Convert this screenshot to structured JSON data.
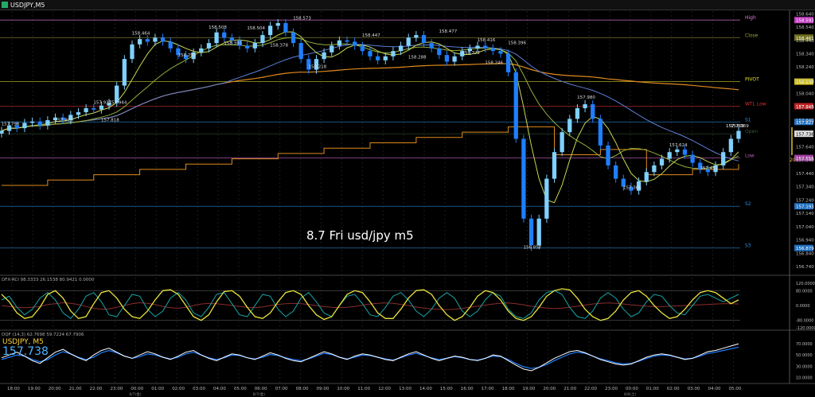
{
  "window": {
    "title": "USDJPY,M5"
  },
  "annotation_text": "8.7 Fri usd/jpy m5",
  "colors": {
    "background": "#000000",
    "candle_bull": "#7fd1ff",
    "candle_bear": "#1f7fff",
    "ma_fast": "#c8d650",
    "ma_mid": "#8fae3c",
    "ma_slow": "#5b7fd6",
    "ma_long": "#e08a1e",
    "pivot_band": "#e08a1e",
    "stoch_k": "#e7e33b",
    "stoch_d": "#16a6a6",
    "rci_long": "#8b2d2d",
    "dmi_main": "#ffffff",
    "dmi_sig": "#1f7fff"
  },
  "levels": [
    {
      "name": "High",
      "value": "158.593",
      "label_color": "#e07fe0",
      "tag_bg": "#c040c0"
    },
    {
      "name": "Close",
      "value": "158.461",
      "label_color": "#a0a040",
      "tag_bg": "#707020"
    },
    {
      "name": "PIVOT",
      "value": "158.130",
      "label_color": "#e0e030",
      "tag_bg": "#d0c020"
    },
    {
      "name": "WTL Low",
      "value": "157.945",
      "label_color": "#e03030",
      "tag_bg": "#c02020"
    },
    {
      "name": "S1",
      "value": "157.827",
      "label_color": "#3090e0",
      "tag_bg": "#2070c0"
    },
    {
      "name": "Open",
      "value": "157.738",
      "label_color": "#3a5a3a",
      "tag_bg": "#303030"
    },
    {
      "name": "Low",
      "value": "157.556",
      "label_color": "#c060c0",
      "tag_bg": "#a040a0"
    },
    {
      "name": "S2",
      "value": "157.193",
      "label_color": "#3090e0",
      "tag_bg": "#2070c0"
    },
    {
      "name": "S3",
      "value": "156.879",
      "label_color": "#3090e0",
      "tag_bg": "#2070c0"
    }
  ],
  "price_axis": [
    "158.640",
    "158.540",
    "158.440",
    "158.340",
    "158.240",
    "158.140",
    "158.040",
    "157.940",
    "157.840",
    "157.740",
    "157.640",
    "157.540",
    "157.440",
    "157.340",
    "157.240",
    "157.140",
    "157.040",
    "156.940",
    "156.840",
    "156.740"
  ],
  "current_price_tag": "157.738",
  "bid_tag": "157.769",
  "spread_label": "20",
  "chart_data": {
    "type": "candlestick",
    "title": "USDJPY,M5",
    "ylim": [
      156.68,
      158.66
    ],
    "x_ticks": [
      "18:00",
      "19:00",
      "20:00",
      "21:00",
      "22:00",
      "23:00",
      "00:00",
      "01:00",
      "02:00",
      "03:00",
      "04:00",
      "05:00",
      "06:00",
      "07:00",
      "08:00",
      "09:00",
      "10:00",
      "11:00",
      "12:00",
      "13:00",
      "14:00",
      "15:00",
      "16:00",
      "17:00",
      "18:00",
      "19:00",
      "20:00",
      "21:00",
      "22:00",
      "23:00",
      "00:00",
      "01:00",
      "02:00",
      "03:00",
      "04:00",
      "05:00"
    ],
    "date_marks": [
      {
        "text": "8/7(金)",
        "at_tick": 6
      },
      {
        "text": "8/7(金)",
        "at_tick": 12
      },
      {
        "text": "8/8(土)",
        "at_tick": 30
      }
    ],
    "close_path": [
      157.76,
      157.8,
      157.78,
      157.82,
      157.83,
      157.8,
      157.84,
      157.86,
      157.84,
      157.88,
      157.9,
      157.93,
      157.92,
      157.95,
      157.97,
      158.1,
      158.3,
      158.41,
      158.45,
      158.43,
      158.46,
      158.43,
      158.38,
      158.33,
      158.3,
      158.35,
      158.38,
      158.42,
      158.5,
      158.46,
      158.44,
      158.4,
      158.38,
      158.42,
      158.48,
      158.55,
      158.57,
      158.5,
      158.42,
      158.3,
      158.22,
      158.3,
      158.35,
      158.4,
      158.44,
      158.43,
      158.4,
      158.36,
      158.32,
      158.29,
      158.32,
      158.36,
      158.4,
      158.46,
      158.48,
      158.42,
      158.38,
      158.33,
      158.28,
      158.32,
      158.36,
      158.38,
      158.4,
      158.38,
      158.36,
      158.34,
      158.2,
      157.7,
      157.1,
      156.9,
      157.1,
      157.4,
      157.6,
      157.75,
      157.85,
      157.93,
      157.96,
      157.85,
      157.65,
      157.5,
      157.4,
      157.34,
      157.31,
      157.38,
      157.45,
      157.5,
      157.55,
      157.6,
      157.62,
      157.58,
      157.52,
      157.47,
      157.45,
      157.5,
      157.6,
      157.7,
      157.76
    ],
    "annotations": [
      {
        "text": "157.798",
        "i": 1,
        "price": 157.785
      },
      {
        "text": "157.820",
        "i": 8,
        "price": 157.815
      },
      {
        "text": "157.937",
        "i": 13,
        "price": 157.946
      },
      {
        "text": "157.818",
        "i": 14,
        "price": 157.813
      },
      {
        "text": "157.944",
        "i": 15,
        "price": 157.946
      },
      {
        "text": "158.464",
        "i": 18,
        "price": 158.465
      },
      {
        "text": "158.295",
        "i": 24,
        "price": 158.3
      },
      {
        "text": "158.508",
        "i": 28,
        "price": 158.51
      },
      {
        "text": "158.393",
        "i": 30,
        "price": 158.39
      },
      {
        "text": "158.504",
        "i": 33,
        "price": 158.505
      },
      {
        "text": "158.378",
        "i": 36,
        "price": 158.375
      },
      {
        "text": "158.573",
        "i": 39,
        "price": 158.58
      },
      {
        "text": "158.218",
        "i": 41,
        "price": 158.215
      },
      {
        "text": "158.447",
        "i": 48,
        "price": 158.45
      },
      {
        "text": "158.288",
        "i": 54,
        "price": 158.285
      },
      {
        "text": "158.477",
        "i": 58,
        "price": 158.48
      },
      {
        "text": "158.322",
        "i": 61,
        "price": 158.32
      },
      {
        "text": "158.416",
        "i": 63,
        "price": 158.415
      },
      {
        "text": "158.246",
        "i": 64,
        "price": 158.245
      },
      {
        "text": "158.396",
        "i": 67,
        "price": 158.395
      },
      {
        "text": "156.857",
        "i": 69,
        "price": 156.857
      },
      {
        "text": "157.980",
        "i": 76,
        "price": 157.985
      },
      {
        "text": "157.306",
        "i": 82,
        "price": 157.306
      },
      {
        "text": "157.624",
        "i": 88,
        "price": 157.625
      },
      {
        "text": "157.452",
        "i": 92,
        "price": 157.452
      },
      {
        "text": "157.769",
        "i": 96,
        "price": 157.77
      }
    ]
  },
  "rci_panel": {
    "header": "DFX-RCI 98.3333 26.1538 80.9421 0.0000",
    "axis": [
      "120.0000",
      "80.0000",
      "0.0000",
      "-80.0000",
      "-120.0000"
    ],
    "yellow": [
      60,
      20,
      -40,
      -70,
      -60,
      -10,
      60,
      80,
      40,
      -30,
      -70,
      -60,
      10,
      70,
      80,
      40,
      -20,
      -60,
      -70,
      -30,
      30,
      80,
      85,
      60,
      0,
      -60,
      -80,
      -50,
      20,
      75,
      80,
      50,
      -10,
      -60,
      -70,
      -40,
      20,
      70,
      80,
      60,
      0,
      -50,
      -75,
      -60,
      0,
      60,
      80,
      70,
      20,
      -40,
      -70,
      -70,
      -20,
      40,
      80,
      85,
      60,
      0,
      -50,
      -80,
      -60,
      -10,
      50,
      80,
      70,
      30,
      -30,
      -70,
      -80,
      -60,
      -10,
      50,
      80,
      90,
      85,
      40,
      -20,
      -60,
      -80,
      -70,
      -30,
      30,
      70,
      80,
      50,
      0,
      -40,
      -70,
      -60,
      -20,
      30,
      70,
      80,
      70,
      40,
      10,
      30
    ],
    "cyan": [
      30,
      50,
      -10,
      -50,
      -20,
      40,
      70,
      30,
      -40,
      -70,
      -20,
      50,
      70,
      20,
      -50,
      -60,
      0,
      60,
      50,
      -20,
      -60,
      -30,
      40,
      70,
      30,
      -40,
      -60,
      -10,
      60,
      70,
      10,
      -50,
      -60,
      0,
      60,
      50,
      -20,
      -60,
      -30,
      40,
      70,
      20,
      -40,
      -60,
      0,
      50,
      60,
      10,
      -50,
      -60,
      -10,
      50,
      70,
      30,
      -30,
      -60,
      -20,
      40,
      70,
      40,
      -30,
      -60,
      -30,
      30,
      70,
      50,
      -20,
      -60,
      -70,
      -40,
      30,
      70,
      80,
      60,
      -10,
      -60,
      -70,
      -30,
      40,
      70,
      40,
      -20,
      -60,
      -40,
      20,
      60,
      50,
      0,
      -40,
      -50,
      0,
      50,
      60,
      40,
      20,
      40,
      60
    ],
    "red": [
      0,
      -5,
      -10,
      -12,
      -10,
      -5,
      5,
      10,
      15,
      12,
      5,
      -5,
      -15,
      -20,
      -18,
      -10,
      0,
      10,
      15,
      12,
      5,
      -5,
      -12,
      -15,
      -10,
      0,
      8,
      12,
      10,
      5,
      0,
      -5,
      -10,
      -12,
      -8,
      0,
      6,
      10,
      12,
      10,
      5,
      0,
      -6,
      -10,
      -12,
      -10,
      -5,
      2,
      8,
      12,
      14,
      12,
      6,
      0,
      -8,
      -14,
      -18,
      -20,
      -22,
      -20,
      -16,
      -10,
      -4,
      2,
      8,
      12,
      14,
      10,
      4,
      -4,
      -10,
      -14,
      -16,
      -14,
      -10,
      -4,
      2,
      8,
      12,
      14,
      12,
      8,
      4,
      0,
      -4,
      -6,
      -6,
      -4,
      -2,
      0,
      2,
      4,
      6,
      8,
      10,
      10,
      8
    ]
  },
  "dmi_panel": {
    "header": "DQF (14,3) 62.7698 59.7224 67.7906",
    "symbol": "USDJPY, M5",
    "price": "157.738",
    "axis": [
      "70.0000",
      "50.0000",
      "30.0000",
      "10.0000"
    ],
    "white": [
      45,
      50,
      55,
      48,
      40,
      35,
      45,
      55,
      60,
      52,
      45,
      40,
      50,
      58,
      62,
      55,
      48,
      44,
      50,
      56,
      52,
      46,
      42,
      48,
      55,
      58,
      50,
      44,
      40,
      46,
      52,
      50,
      45,
      42,
      48,
      54,
      50,
      44,
      40,
      38,
      44,
      50,
      56,
      52,
      46,
      42,
      48,
      52,
      50,
      46,
      42,
      40,
      46,
      52,
      56,
      50,
      44,
      40,
      44,
      48,
      46,
      42,
      40,
      44,
      50,
      48,
      40,
      32,
      25,
      22,
      28,
      36,
      44,
      50,
      56,
      58,
      54,
      48,
      42,
      38,
      34,
      32,
      34,
      40,
      46,
      50,
      52,
      50,
      46,
      42,
      44,
      50,
      56,
      58,
      62,
      66,
      70
    ],
    "blue": [
      42,
      46,
      50,
      48,
      42,
      38,
      42,
      50,
      56,
      52,
      46,
      42,
      46,
      54,
      58,
      54,
      48,
      44,
      47,
      52,
      50,
      46,
      43,
      46,
      52,
      55,
      50,
      45,
      42,
      45,
      50,
      49,
      45,
      43,
      46,
      51,
      49,
      45,
      42,
      40,
      43,
      48,
      53,
      51,
      46,
      43,
      46,
      50,
      49,
      46,
      43,
      41,
      45,
      50,
      53,
      49,
      45,
      42,
      44,
      47,
      45,
      42,
      41,
      44,
      48,
      47,
      42,
      35,
      29,
      26,
      28,
      33,
      40,
      46,
      52,
      55,
      53,
      48,
      43,
      40,
      36,
      34,
      35,
      39,
      44,
      48,
      50,
      49,
      46,
      43,
      44,
      48,
      53,
      55,
      58,
      61,
      64
    ]
  }
}
